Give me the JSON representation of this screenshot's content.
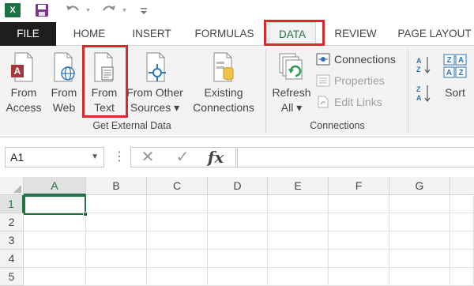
{
  "qat": {
    "app_icon_letter": "X",
    "icons": [
      "excel-icon",
      "save-icon",
      "undo-icon",
      "redo-icon",
      "customize-qat-icon"
    ]
  },
  "tabs": {
    "file": "FILE",
    "home": "HOME",
    "insert": "INSERT",
    "formulas": "FORMULAS",
    "data": "DATA",
    "review": "REVIEW",
    "page_layout": "PAGE LAYOUT"
  },
  "ribbon": {
    "get_external_data": {
      "group_label": "Get External Data",
      "from_access": [
        "From",
        "Access"
      ],
      "from_web": [
        "From",
        "Web"
      ],
      "from_text": [
        "From",
        "Text"
      ],
      "from_other_sources": [
        "From Other",
        "Sources ▾"
      ],
      "existing_connections": [
        "Existing",
        "Connections"
      ]
    },
    "connections": {
      "group_label": "Connections",
      "refresh_all": [
        "Refresh",
        "All ▾"
      ],
      "connections_label": "Connections",
      "properties_label": "Properties",
      "edit_links_label": "Edit Links"
    },
    "sort": {
      "sort_label": "Sort"
    }
  },
  "formula_bar": {
    "name_box": "A1",
    "fx": "fx",
    "formula": ""
  },
  "grid": {
    "columns": [
      "A",
      "B",
      "C",
      "D",
      "E",
      "F",
      "G"
    ],
    "rows": [
      "1",
      "2",
      "3",
      "4",
      "5"
    ],
    "active_cell": "A1"
  },
  "colors": {
    "excel_green": "#217346",
    "highlight_red": "#d9282e",
    "file_tab_bg": "#1e1e1e"
  }
}
